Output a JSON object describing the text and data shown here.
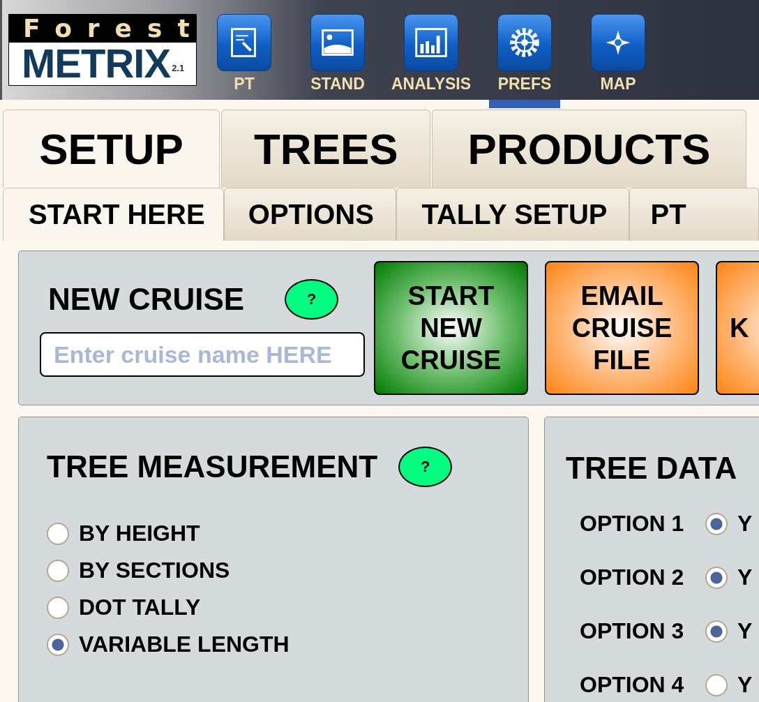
{
  "logo": {
    "top": "Forest",
    "main": "METRIX",
    "version": "2.1"
  },
  "nav": [
    {
      "label": "PT",
      "kind": "note",
      "selected": false
    },
    {
      "label": "STAND",
      "kind": "picture",
      "selected": false
    },
    {
      "label": "ANALYSIS",
      "kind": "chart",
      "selected": false
    },
    {
      "label": "PREFS",
      "kind": "gear",
      "selected": true
    },
    {
      "label": "MAP",
      "kind": "compass",
      "selected": false
    }
  ],
  "tabs": [
    {
      "label": "SETUP",
      "selected": true
    },
    {
      "label": "TREES",
      "selected": false
    },
    {
      "label": "PRODUCTS",
      "selected": false
    }
  ],
  "subtabs": [
    {
      "label": "START HERE",
      "selected": true
    },
    {
      "label": "OPTIONS",
      "selected": false
    },
    {
      "label": "TALLY SETUP",
      "selected": false
    },
    {
      "label": "PT",
      "selected": false
    }
  ],
  "new_cruise": {
    "title": "NEW CRUISE",
    "help": "?",
    "input": {
      "placeholder": "Enter cruise name HERE"
    },
    "buttons": [
      {
        "kind": "start",
        "lines": [
          "START",
          "NEW",
          "CRUISE"
        ]
      },
      {
        "kind": "action",
        "lines": [
          "EMAIL",
          "CRUISE",
          "FILE"
        ]
      },
      {
        "kind": "action",
        "lines": [
          "K"
        ]
      }
    ]
  },
  "tree_measurement": {
    "title": "TREE MEASUREMENT",
    "help": "?",
    "options": [
      {
        "label": "BY HEIGHT",
        "selected": false
      },
      {
        "label": "BY SECTIONS",
        "selected": false
      },
      {
        "label": "DOT TALLY",
        "selected": false
      },
      {
        "label": "VARIABLE LENGTH",
        "selected": true
      }
    ]
  },
  "tree_data": {
    "title": "TREE DATA",
    "options": [
      {
        "label": "OPTION 1",
        "value": "Y",
        "selected": true
      },
      {
        "label": "OPTION 2",
        "value": "Y",
        "selected": true
      },
      {
        "label": "OPTION 3",
        "value": "Y",
        "selected": true
      },
      {
        "label": "OPTION 4",
        "value": "Y",
        "selected": false
      }
    ]
  }
}
